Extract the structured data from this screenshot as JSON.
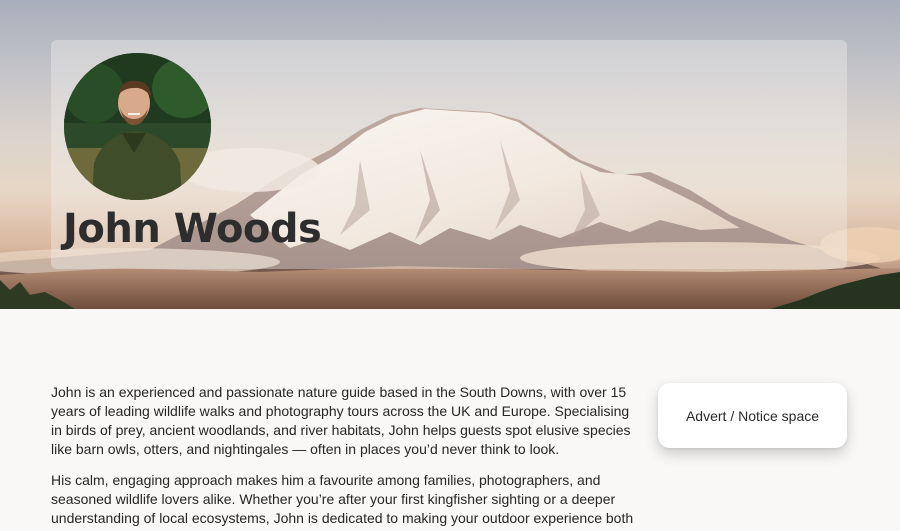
{
  "profile": {
    "name": "John Woods"
  },
  "bio": {
    "paragraph_1": "John is an experienced and passionate nature guide based in the South Downs, with over 15 years of leading wildlife walks and photography tours across the UK and Europe. Specialising in birds of prey, ancient woodlands, and river habitats, John helps guests spot elusive species like barn owls, otters, and nightingales — often in places you’d never think to look.",
    "paragraph_2": "His calm, engaging approach makes him a favourite among families, photographers, and seasoned wildlife lovers alike. Whether you’re after your first kingfisher sighting or a deeper understanding of local ecosystems, John is dedicated to making your outdoor experience both"
  },
  "sidebar": {
    "advert_label": "Advert / Notice space"
  }
}
